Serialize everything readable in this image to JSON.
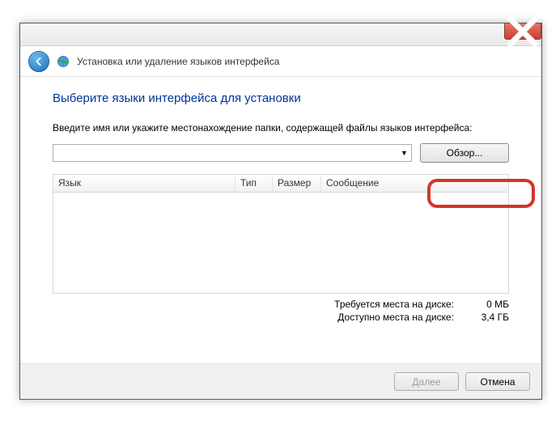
{
  "window": {
    "title": "Установка или удаление языков интерфейса"
  },
  "page": {
    "heading": "Выберите языки интерфейса для установки",
    "instruction": "Введите имя или укажите местонахождение папки, содержащей файлы языков интерфейса:",
    "browse_label": "Обзор...",
    "path_value": ""
  },
  "grid": {
    "columns": {
      "lang": "Язык",
      "type": "Тип",
      "size": "Размер",
      "msg": "Сообщение"
    }
  },
  "disk": {
    "required_label": "Требуется места на диске:",
    "required_value": "0 МБ",
    "available_label": "Доступно места на диске:",
    "available_value": "3,4 ГБ"
  },
  "footer": {
    "next": "Далее",
    "cancel": "Отмена"
  }
}
